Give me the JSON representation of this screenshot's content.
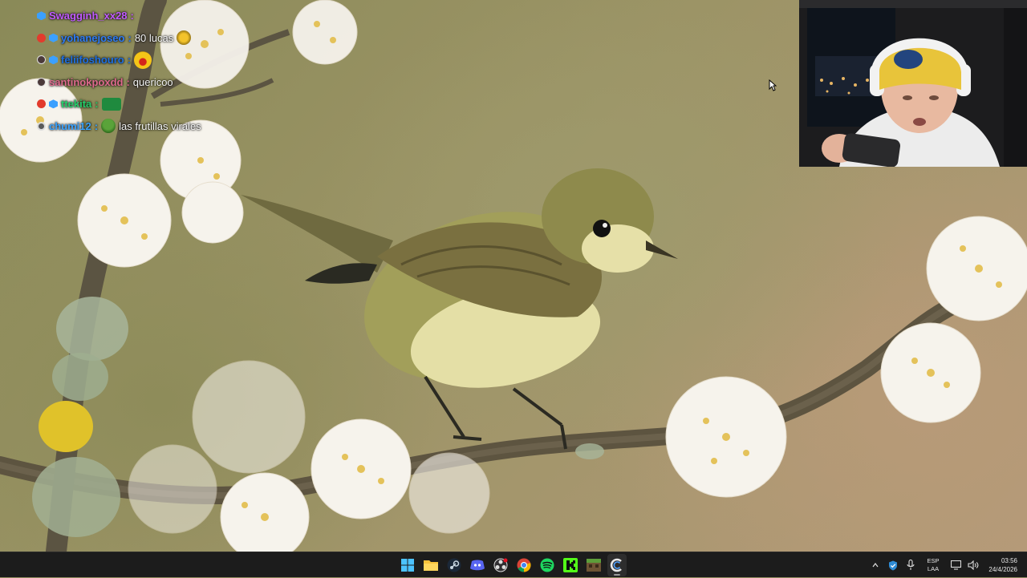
{
  "chat": {
    "messages": [
      {
        "user": "Swagginh_xx28",
        "user_color": "#c15bff",
        "text": "",
        "badges": [
          "blue-badge"
        ]
      },
      {
        "user": "yohanejoseo",
        "user_color": "#2e7cf6",
        "text": "80 lucas",
        "badges": [
          "red-badge",
          "blue-badge"
        ],
        "emote": "coin-emote"
      },
      {
        "user": "feliifoshouro",
        "user_color": "#1f6fe0",
        "text": "",
        "badges": [
          "dark-badge",
          "blue-badge"
        ],
        "emote": "laughing-emote"
      },
      {
        "user": "santinokpoxdd",
        "user_color": "#e06a8e",
        "text": "quericoo",
        "badges": [
          "dark-badge"
        ]
      },
      {
        "user": "ttekita",
        "user_color": "#25d06a",
        "text": "",
        "badges": [
          "red-badge",
          "blue-badge"
        ],
        "emote": "green-emote"
      },
      {
        "user": "chumi12",
        "user_color": "#3aa3ff",
        "text": "las frutillas virales",
        "badges": [
          "gray-badge"
        ],
        "emote": "pepe-emote"
      }
    ]
  },
  "taskbar": {
    "apps": [
      {
        "name": "start-icon"
      },
      {
        "name": "file-explorer-icon"
      },
      {
        "name": "steam-icon"
      },
      {
        "name": "discord-icon"
      },
      {
        "name": "obs-icon"
      },
      {
        "name": "chrome-icon"
      },
      {
        "name": "spotify-icon"
      },
      {
        "name": "kick-icon"
      },
      {
        "name": "minecraft-icon"
      },
      {
        "name": "app-c-icon",
        "active": true
      }
    ],
    "tray": {
      "lang_line1": "ESP",
      "lang_line2": "LAA",
      "time": "03:56",
      "date": "24/4/2026"
    }
  },
  "colors": {
    "taskbar_bg": "#1c1c1c",
    "spotify": "#1ed760",
    "kick": "#53fc18",
    "discord": "#5865f2"
  }
}
